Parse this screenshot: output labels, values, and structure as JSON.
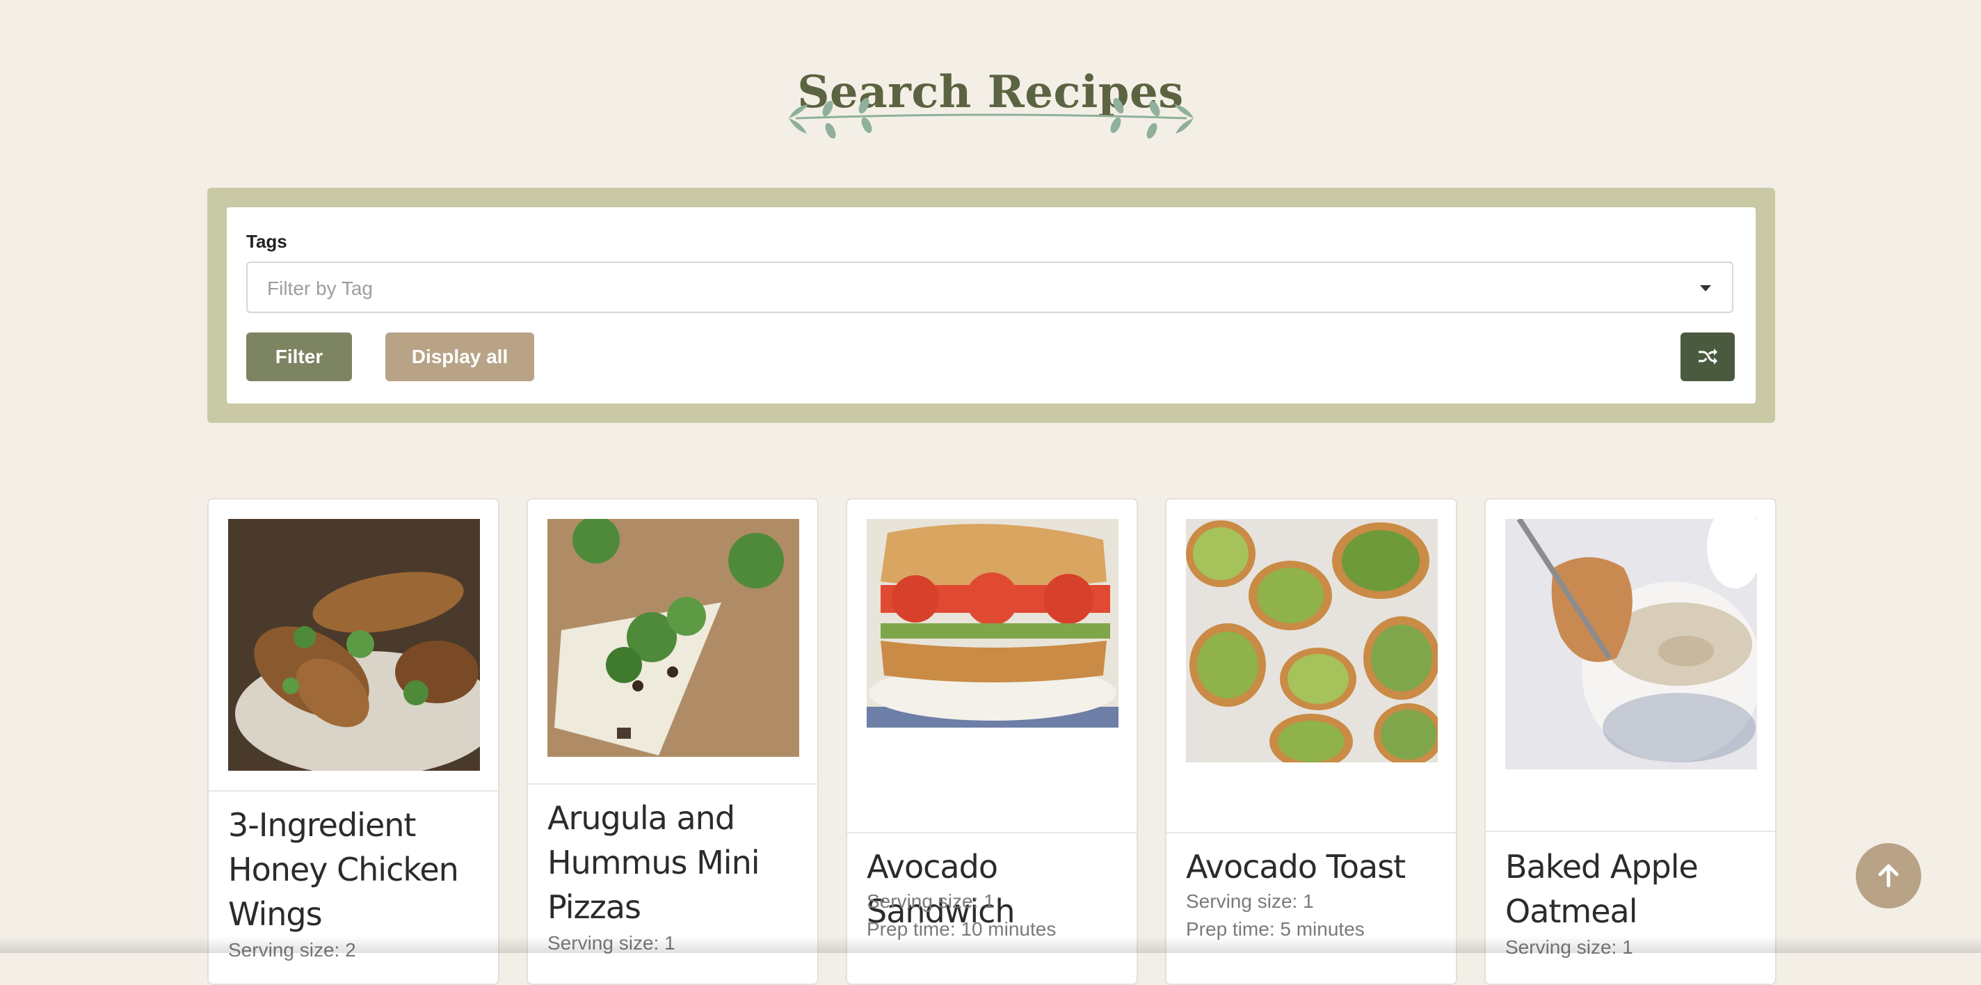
{
  "page": {
    "title": "Search Recipes"
  },
  "filter": {
    "tags_label": "Tags",
    "tag_placeholder": "Filter by Tag",
    "filter_button": "Filter",
    "display_all_button": "Display all",
    "shuffle_icon": "shuffle-icon"
  },
  "recipes": [
    {
      "title": "3-Ingredient Honey Chicken Wings",
      "serving": "Serving size: 2",
      "prep": ""
    },
    {
      "title": "Arugula and Hummus Mini Pizzas",
      "serving": "Serving size: 1",
      "prep": ""
    },
    {
      "title": "Avocado Sandwich",
      "serving": "Serving size: 1",
      "prep": "Prep time: 10 minutes"
    },
    {
      "title": "Avocado Toast",
      "serving": "Serving size: 1",
      "prep": "Prep time: 5 minutes"
    },
    {
      "title": "Baked Apple Oatmeal",
      "serving": "Serving size: 1",
      "prep": ""
    }
  ],
  "colors": {
    "background": "#f3efe7",
    "panel": "#c9c9a6",
    "filter_button": "#7d8461",
    "display_all_button": "#b8a387",
    "shuffle_button": "#4a5a3e",
    "title": "#5c6340"
  },
  "back_to_top_icon": "arrow-up-icon"
}
